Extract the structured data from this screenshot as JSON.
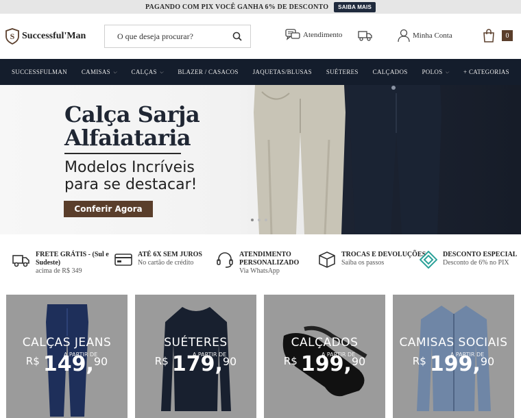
{
  "promo": {
    "text": "PAGANDO COM PIX VOCÊ GANHA 6% DE DESCONTO",
    "button": "SAIBA MAIS"
  },
  "header": {
    "logo_text": "Successful'Man",
    "search_placeholder": "O que deseja procurar?",
    "atendimento": "Atendimento",
    "minha_conta": "Minha Conta",
    "cart_count": "0"
  },
  "nav": {
    "items": [
      {
        "label": "SUCCESSFULMAN",
        "dropdown": false
      },
      {
        "label": "CAMISAS",
        "dropdown": true
      },
      {
        "label": "CALÇAS",
        "dropdown": true
      },
      {
        "label": "BLAZER / CASACOS",
        "dropdown": false
      },
      {
        "label": "JAQUETAS/BLUSAS",
        "dropdown": false
      },
      {
        "label": "SUÉTERES",
        "dropdown": false
      },
      {
        "label": "CALÇADOS",
        "dropdown": false
      },
      {
        "label": "POLOS",
        "dropdown": true
      },
      {
        "label": "+ CATEGORIAS",
        "dropdown": false
      }
    ]
  },
  "hero": {
    "title_line1": "Calça Sarja",
    "title_line2": "Alfaiataria",
    "subtitle_line1": "Modelos Incríveis",
    "subtitle_line2": "para se destacar!",
    "cta": "Conferir Agora"
  },
  "benefits": [
    {
      "title": "FRETE GRÁTIS - (Sul e",
      "title2": "Sudeste)",
      "sub": "acima de R$ 349",
      "icon": "truck-icon"
    },
    {
      "title": "ATÉ 6X SEM JUROS",
      "title2": "",
      "sub": "No cartão de crédito",
      "icon": "credit-card-icon"
    },
    {
      "title": "ATENDIMENTO",
      "title2": "PERSONALIZADO",
      "sub": "Via WhatsApp",
      "icon": "headset-icon"
    },
    {
      "title": "TROCAS E DEVOLUÇÕES",
      "title2": "",
      "sub": "Saiba os passos",
      "icon": "box-icon"
    },
    {
      "title": "DESCONTO ESPECIAL",
      "title2": "",
      "sub": "Desconto de 6% no PIX",
      "icon": "pix-icon"
    }
  ],
  "cards": [
    {
      "category": "CALÇAS JEANS",
      "from": "A PARTIR DE",
      "currency": "R$",
      "price": "149",
      "cents": "90"
    },
    {
      "category": "SUÉTERES",
      "from": "A PARTIR DE",
      "currency": "R$",
      "price": "179",
      "cents": "90"
    },
    {
      "category": "CALÇADOS",
      "from": "A PARTIR DE",
      "currency": "R$",
      "price": "199",
      "cents": "90"
    },
    {
      "category": "CAMISAS SOCIAIS",
      "from": "A PARTIR DE",
      "currency": "R$",
      "price": "199",
      "cents": "90"
    }
  ],
  "colors": {
    "nav_bg": "#141d2c",
    "accent_brown": "#5a3e2b",
    "pix_teal": "#2aa198"
  }
}
